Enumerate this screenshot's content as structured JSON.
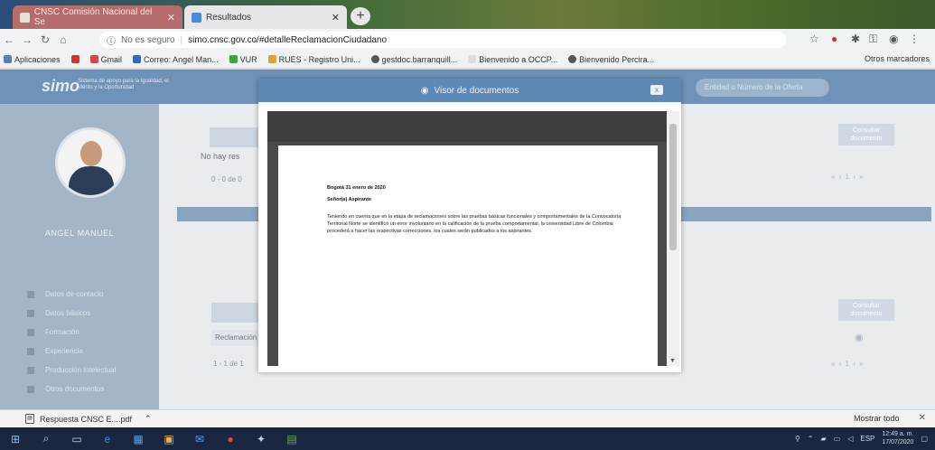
{
  "browser": {
    "tabs": [
      {
        "label": "CNSC Comisión Nacional del Se",
        "active": false
      },
      {
        "label": "Resultados",
        "active": true
      }
    ],
    "new_tab_label": "+",
    "address": {
      "security_label": "No es seguro",
      "url": "simo.cnsc.gov.co/#detalleReclamacionCiudadano"
    },
    "bookmarks": [
      "Aplicaciones",
      "Gmail",
      "Correo: Angel Man...",
      "VUR",
      "RUES - Registro Uni...",
      "gestdoc.barranquill...",
      "Bienvenido a OCCP...",
      "Bienvenido Percira..."
    ],
    "other_bookmarks": "Otros marcadores"
  },
  "site": {
    "logo": "simo",
    "tagline": "Sistema de apoyo para la Igualdad, el Mérito y la Oportunidad",
    "search_placeholder": "Entidad o Número de la Oferta",
    "user_name": "ANGEL MANUEL",
    "menu": [
      "Datos de contacto",
      "Datos básicos",
      "Formación",
      "Experiencia",
      "Producción intelectual",
      "Otros documentos"
    ],
    "section1": {
      "no_results": "No hay res",
      "pagination": "0 - 0 de 0",
      "consult_button": "Consultar documento",
      "pager": "« ‹ 1 › »"
    },
    "section2": {
      "row_label": "Reclamación",
      "pagination": "1 - 1 de 1",
      "consult_button": "Consultar documento",
      "pager": "« ‹ 1 › »"
    }
  },
  "modal": {
    "title": "Visor de documentos",
    "close_label": "x",
    "document": {
      "date": "Bogotá 31 enero de 2020",
      "greeting": "Señor(a) Aspirante",
      "body": "Teniendo en cuenta que en la etapa de reclamaciones sobre las pruebas básicas funcionales y comportamentales de la Convocatoria Territorial Norte se identificó un error involuntario en la calificación de la prueba comportamental, la universidad Libre de Colombia procederá a hacer las respectivas correcciones, los cuales serán publicados a los aspirantes."
    }
  },
  "downloads": {
    "file": "Respuesta CNSC E....pdf",
    "show_all": "Mostrar todo"
  },
  "taskbar": {
    "language": "ESP",
    "time": "12:49 a. m.",
    "date": "17/07/2020"
  }
}
